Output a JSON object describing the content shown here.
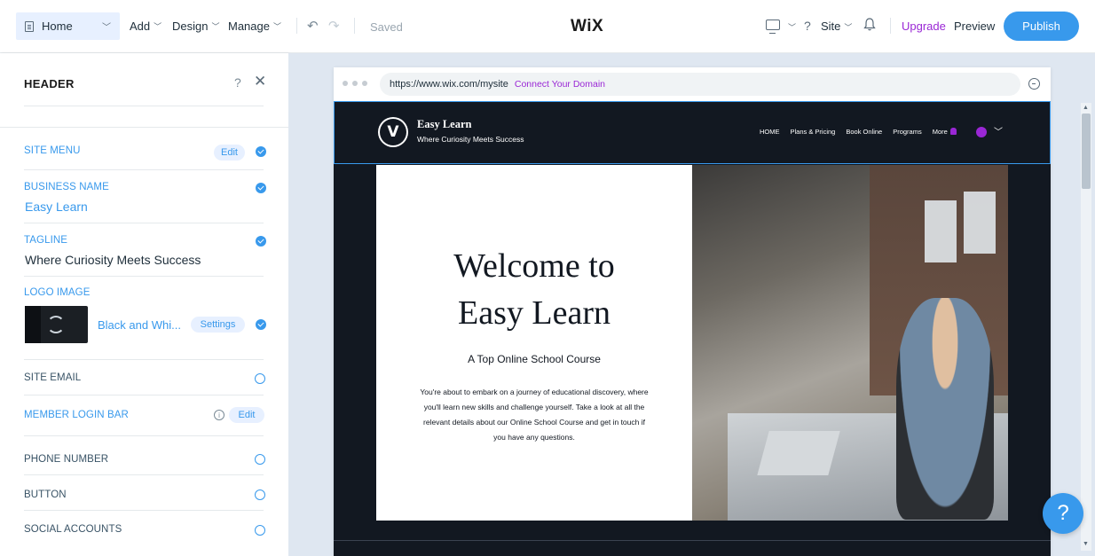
{
  "topbar": {
    "page_selector": "Home",
    "menus": [
      "Add",
      "Design",
      "Manage"
    ],
    "saved_status": "Saved",
    "brand": "WiX",
    "help": "?",
    "site_menu": "Site",
    "upgrade": "Upgrade",
    "preview": "Preview",
    "publish": "Publish"
  },
  "panel": {
    "title": "HEADER",
    "help": "?",
    "site_menu": {
      "label": "SITE MENU",
      "action": "Edit"
    },
    "business_name": {
      "label": "BUSINESS NAME",
      "value": "Easy Learn"
    },
    "tagline": {
      "label": "TAGLINE",
      "value": "Where Curiosity Meets Success"
    },
    "logo_image": {
      "label": "LOGO IMAGE",
      "name": "Black and Whi...",
      "action": "Settings"
    },
    "site_email": {
      "label": "SITE EMAIL"
    },
    "member_login_bar": {
      "label": "MEMBER LOGIN BAR",
      "info": "i",
      "action": "Edit"
    },
    "phone_number": {
      "label": "PHONE NUMBER"
    },
    "button": {
      "label": "BUTTON"
    },
    "social_accounts": {
      "label": "SOCIAL ACCOUNTS"
    }
  },
  "browser": {
    "url": "https://www.wix.com/mysite",
    "connect": "Connect Your Domain"
  },
  "site": {
    "logo_glyph": "V",
    "name": "Easy Learn",
    "tagline": "Where Curiosity Meets Success",
    "nav": [
      "HOME",
      "Plans & Pricing",
      "Book Online",
      "Programs",
      "More"
    ],
    "hero": {
      "title_line1": "Welcome to",
      "title_line2": "Easy Learn",
      "subtitle": "A Top Online School Course",
      "body_line1": "You're about to embark on a journey of educational discovery, where",
      "body_line2": "you'll learn new skills and challenge yourself. Take a look at all the",
      "body_line3": "relevant details about our Online School Course and get in touch if",
      "body_line4": "you have any questions."
    }
  },
  "help_button": "?",
  "colors": {
    "accent": "#3899ec",
    "upgrade": "#9a27d5",
    "site_bg": "#121821",
    "stage_bg": "#dfe7f1"
  }
}
